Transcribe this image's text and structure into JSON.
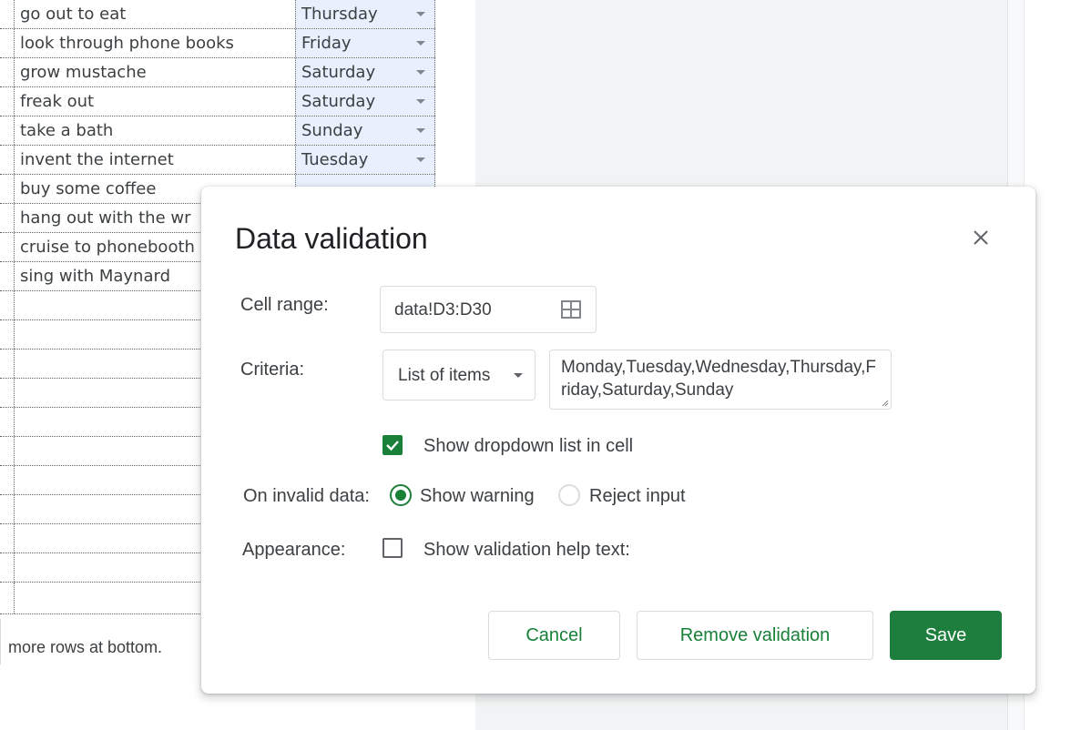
{
  "sheet": {
    "rows": [
      {
        "task": "go out to eat",
        "day": "Thursday"
      },
      {
        "task": "look through phone books",
        "day": "Friday"
      },
      {
        "task": "grow mustache",
        "day": "Saturday"
      },
      {
        "task": "freak out",
        "day": "Saturday"
      },
      {
        "task": "take a bath",
        "day": "Sunday"
      },
      {
        "task": "invent the internet",
        "day": "Tuesday"
      },
      {
        "task": "buy some coffee",
        "day": ""
      },
      {
        "task": "hang out with the wr",
        "day": ""
      },
      {
        "task": "cruise to phonebooth",
        "day": ""
      },
      {
        "task": "sing with Maynard",
        "day": ""
      }
    ],
    "bottom_text": "more rows at bottom."
  },
  "dialog": {
    "title": "Data validation",
    "close_icon": "close-icon",
    "cell_range_label": "Cell range:",
    "cell_range_value": "data!D3:D30",
    "criteria_label": "Criteria:",
    "criteria_type": "List of items",
    "criteria_items": "Monday,Tuesday,Wednesday,Thursday,Friday,Saturday,Sunday",
    "show_dropdown_label": "Show dropdown list in cell",
    "show_dropdown_checked": true,
    "invalid_label": "On invalid data:",
    "show_warning_label": "Show warning",
    "reject_input_label": "Reject input",
    "invalid_selected": "Show warning",
    "appearance_label": "Appearance:",
    "help_text_label": "Show validation help text:",
    "help_text_checked": false,
    "cancel_label": "Cancel",
    "remove_label": "Remove validation",
    "save_label": "Save"
  },
  "colors": {
    "accent": "#188038",
    "selection": "#e8f0fe"
  }
}
